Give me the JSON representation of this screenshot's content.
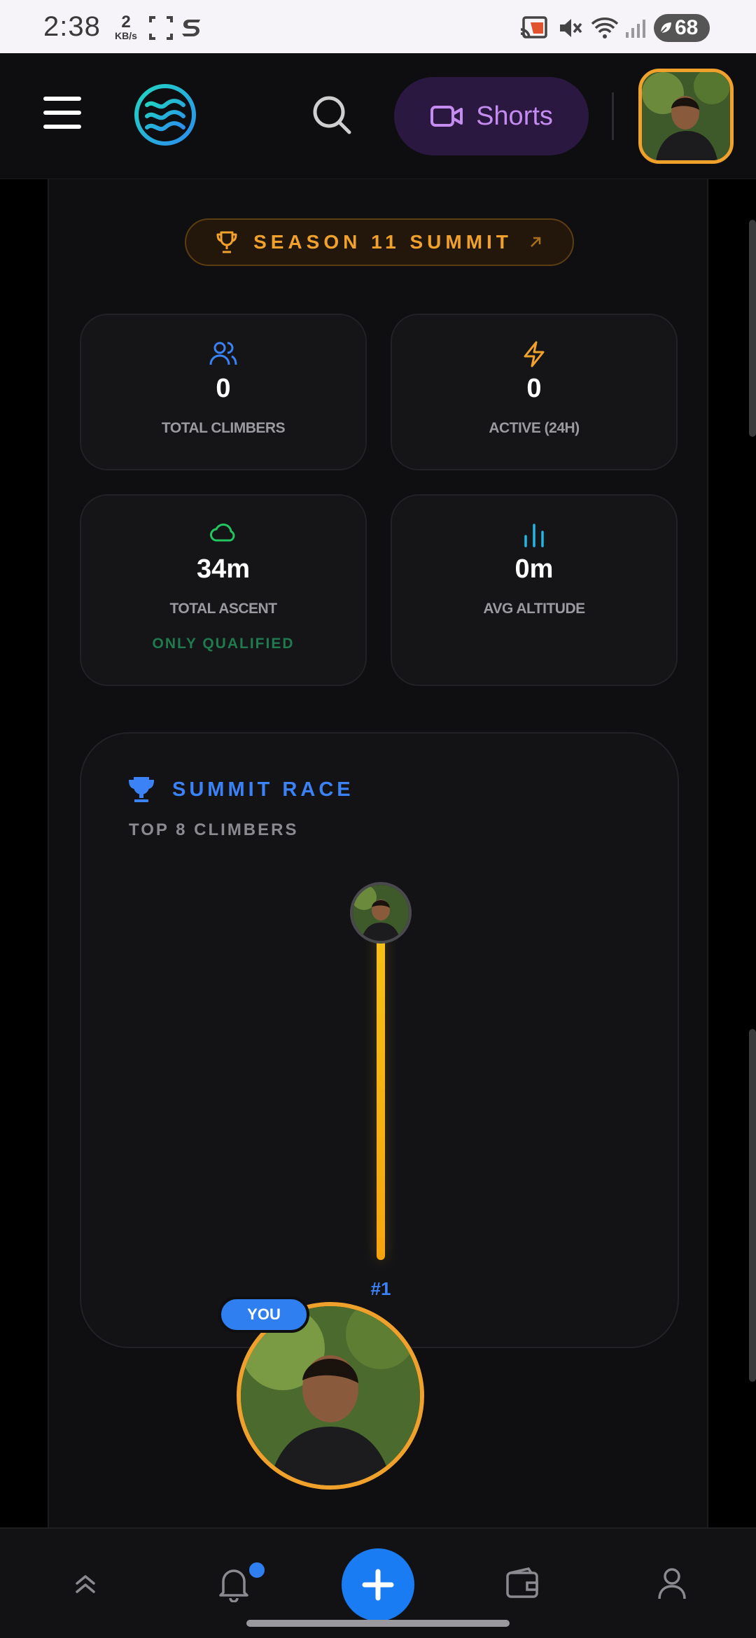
{
  "status_bar": {
    "time": "2:38",
    "net_speed_value": "2",
    "net_speed_unit": "KB/s",
    "battery": "68"
  },
  "header": {
    "shorts_label": "Shorts"
  },
  "season": {
    "label": "SEASON 11 SUMMIT"
  },
  "stats": [
    {
      "icon": "users-icon",
      "value": "0",
      "label": "TOTAL CLIMBERS",
      "color": "#3b82f6"
    },
    {
      "icon": "lightning-icon",
      "value": "0",
      "label": "ACTIVE (24H)",
      "color": "#f0a12c"
    },
    {
      "icon": "cloud-icon",
      "value": "34m",
      "label": "TOTAL ASCENT",
      "sub": "ONLY QUALIFIED",
      "color": "#22c55e"
    },
    {
      "icon": "bar-chart-icon",
      "value": "0m",
      "label": "AVG ALTITUDE",
      "color": "#22b8e6"
    }
  ],
  "summit_race": {
    "title": "SUMMIT RACE",
    "subtitle": "TOP 8 CLIMBERS",
    "climbers": [
      {
        "rank": "#1",
        "progress": 1.0
      }
    ]
  },
  "you_badge": "YOU",
  "colors": {
    "accent_gold": "#f0a12c",
    "accent_blue": "#3b82f6",
    "accent_purple": "#c58cf0",
    "background": "#0f0f11"
  }
}
